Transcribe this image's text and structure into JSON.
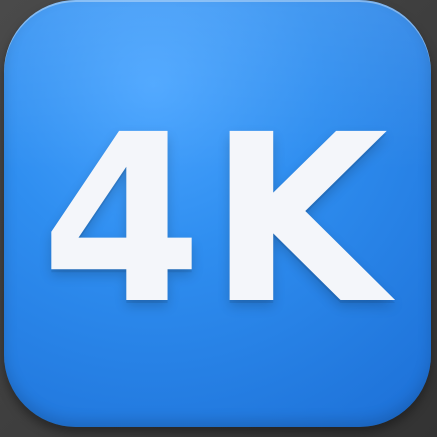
{
  "icon": {
    "label": "4K",
    "background_color": "#2f8ef0",
    "glyph_color": "#f4f6fa"
  }
}
